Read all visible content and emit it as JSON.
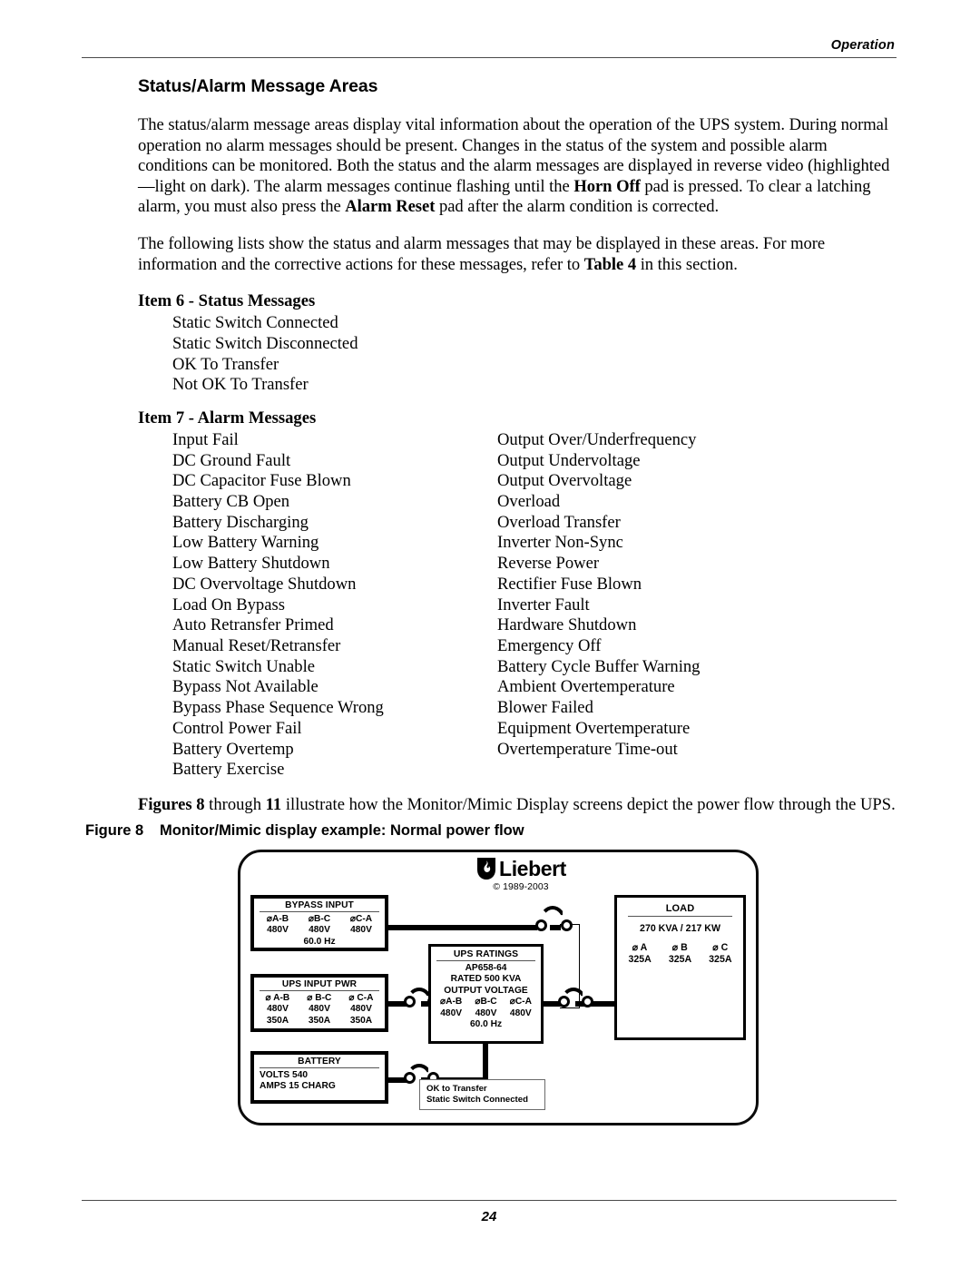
{
  "page": {
    "header_label": "Operation",
    "page_number": "24"
  },
  "section": {
    "title": "Status/Alarm Message Areas",
    "paragraph_1_part1": "The status/alarm message areas display vital information about the operation of the UPS system. During normal operation no alarm messages should be present. Changes in the status of the system and possible alarm conditions can be monitored. Both the status and the alarm messages are displayed in reverse video (highlighted—light on dark). The alarm messages continue flashing until the ",
    "paragraph_1_bold1": "Horn Off",
    "paragraph_1_part2": " pad is pressed. To clear a latching alarm, you must also press the ",
    "paragraph_1_bold2": "Alarm Reset",
    "paragraph_1_part3": " pad after the alarm condition is corrected.",
    "paragraph_2_part1": "The following lists show the status and alarm messages that may be displayed in these areas. For more information and the corrective actions for these messages, refer to ",
    "paragraph_2_bold1": "Table 4",
    "paragraph_2_part2": " in this section."
  },
  "item6": {
    "heading": "Item 6 - Status Messages",
    "messages": [
      "Static Switch Connected",
      "Static Switch Disconnected",
      "OK To Transfer",
      "Not OK To Transfer"
    ]
  },
  "item7": {
    "heading": "Item 7 - Alarm Messages",
    "left_column": [
      "Input Fail",
      "DC Ground Fault",
      "DC Capacitor Fuse Blown",
      "Battery CB Open",
      "Battery Discharging",
      "Low Battery Warning",
      "Low Battery Shutdown",
      "DC Overvoltage Shutdown",
      "Load On Bypass",
      "Auto Retransfer Primed",
      "Manual Reset/Retransfer",
      "Static Switch Unable",
      "Bypass Not Available",
      "Bypass Phase Sequence Wrong",
      "Control Power Fail",
      "Battery Overtemp",
      "Battery Exercise"
    ],
    "right_column": [
      "Output Over/Underfrequency",
      "Output Undervoltage",
      "Output Overvoltage",
      "Overload",
      "Overload Transfer",
      "Inverter Non-Sync",
      "Reverse Power",
      "Rectifier Fuse Blown",
      "Inverter Fault",
      "Hardware Shutdown",
      "Emergency Off",
      "Battery Cycle Buffer Warning",
      "Ambient Overtemperature",
      "Blower Failed",
      "Equipment Overtemperature",
      "Overtemperature Time-out"
    ]
  },
  "figure_intro": {
    "bold1": "Figures 8",
    "text1": " through ",
    "bold2": "11",
    "text2": " illustrate how the Monitor/Mimic Display screens depict the power flow through the UPS."
  },
  "figure": {
    "caption_label": "Figure 8",
    "caption_text": "Monitor/Mimic display example: Normal power flow",
    "logo": {
      "wordmark": "Liebert",
      "copyright": "© 1989-2003"
    },
    "bypass_input": {
      "title": "BYPASS INPUT",
      "phases": [
        "⌀A-B",
        "⌀B-C",
        "⌀C-A"
      ],
      "volts": [
        "480V",
        "480V",
        "480V"
      ],
      "frequency": "60.0 Hz"
    },
    "ups_input_pwr": {
      "title": "UPS INPUT PWR",
      "phases": [
        "⌀ A-B",
        "⌀ B-C",
        "⌀ C-A"
      ],
      "volts": [
        "480V",
        "480V",
        "480V"
      ],
      "amps": [
        "350A",
        "350A",
        "350A"
      ]
    },
    "battery": {
      "title": "BATTERY",
      "volts_line": "VOLTS 540",
      "amps_line": "AMPS 15 CHARG"
    },
    "ups_ratings": {
      "title": "UPS RATINGS",
      "model": "AP658-64",
      "rated": "RATED 500 KVA",
      "output_label": "OUTPUT VOLTAGE",
      "phases": [
        "⌀A-B",
        "⌀B-C",
        "⌀C-A"
      ],
      "volts": [
        "480V",
        "480V",
        "480V"
      ],
      "frequency": "60.0 Hz"
    },
    "load": {
      "title": "LOAD",
      "rating": "270 KVA / 217 KW",
      "phases": [
        "⌀ A",
        "⌀ B",
        "⌀ C"
      ],
      "amps": [
        "325A",
        "325A",
        "325A"
      ]
    },
    "status_box": {
      "line1": "OK to Transfer",
      "line2": "Static Switch Connected"
    }
  }
}
